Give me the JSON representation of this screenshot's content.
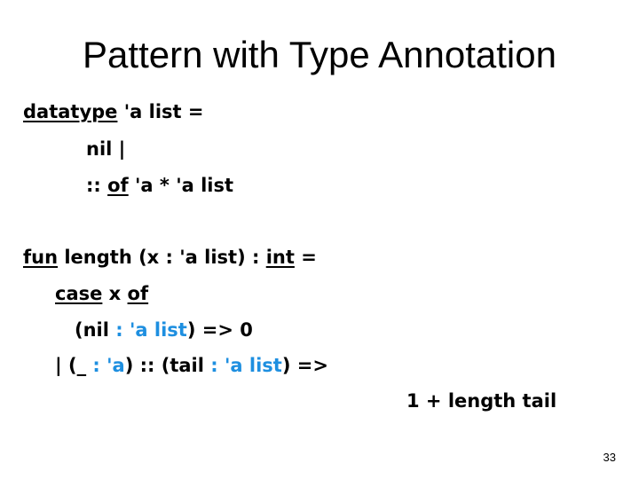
{
  "slide": {
    "title": "Pattern with Type Annotation",
    "page_number": "33",
    "accent_color": "#1e8fe0"
  },
  "code": {
    "datatype_decl": {
      "line1": {
        "kw": "datatype",
        "rest": " 'a list ="
      },
      "line2": {
        "text": "nil |"
      },
      "line3": {
        "pre": ":: ",
        "kw": "of",
        "rest": " 'a * 'a list"
      }
    },
    "function_decl": {
      "line1": {
        "kw1": "fun",
        "mid": " length (x : 'a list) : ",
        "kw2": "int",
        "rest": " ="
      },
      "line2": {
        "kw1": "case",
        "mid": " x ",
        "kw2": "of"
      },
      "line3": {
        "pre": "(nil",
        "blue": " : 'a list",
        "rest": ") => 0"
      },
      "line4": {
        "pre": "| (_",
        "blue1": " : 'a",
        "mid": ") :: (tail",
        "blue2": " : 'a list",
        "rest": ") =>"
      },
      "line5": {
        "text": "1 + length tail"
      }
    }
  }
}
